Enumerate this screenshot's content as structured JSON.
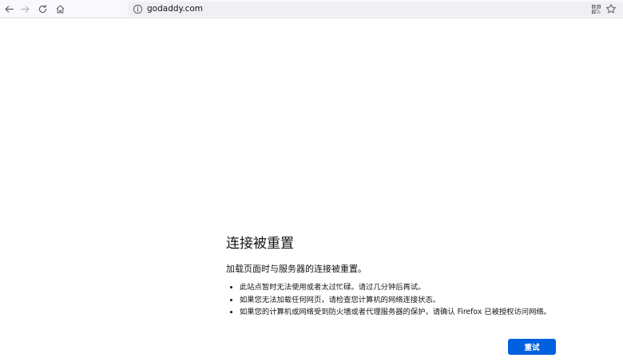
{
  "browser": {
    "url": "godaddy.com"
  },
  "error_page": {
    "title": "连接被重置",
    "description": "加载页面时与服务器的连接被重置。",
    "bullets": [
      "此站点暂时无法使用或者太过忙碌。请过几分钟后再试。",
      "如果您无法加载任何网页，请检查您计算机的网络连接状态。",
      "如果您的计算机或网络受到防火墙或者代理服务器的保护，请确认 Firefox 已被授权访问网络。"
    ],
    "retry_label": "重试"
  },
  "colors": {
    "accent": "#0061e0",
    "toolbar": "#f9f9fb",
    "urlbar": "#f0f0f4"
  }
}
